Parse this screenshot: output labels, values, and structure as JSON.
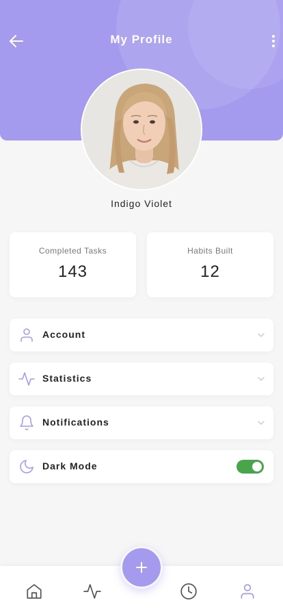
{
  "header": {
    "title": "My Profile",
    "back_icon": "arrow-left-icon",
    "menu_icon": "more-vertical-icon"
  },
  "profile": {
    "name": "Indigo Violet",
    "avatar_icon": "profile-photo"
  },
  "stats": [
    {
      "label": "Completed Tasks",
      "value": "143"
    },
    {
      "label": "Habits Built",
      "value": "12"
    }
  ],
  "menu": {
    "items": [
      {
        "label": "Account",
        "icon": "user-icon"
      },
      {
        "label": "Statistics",
        "icon": "activity-icon"
      },
      {
        "label": "Notifications",
        "icon": "bell-icon"
      },
      {
        "label": "Dark Mode",
        "icon": "moon-icon"
      }
    ],
    "dark_mode_enabled": true
  },
  "bottom_nav": {
    "items": [
      "home-icon",
      "activity-icon",
      "clock-icon",
      "user-icon"
    ],
    "fab_icon": "plus-icon"
  },
  "colors": {
    "accent": "#a59bee",
    "toggle_on": "#47a649",
    "background": "#f6f6f6"
  }
}
